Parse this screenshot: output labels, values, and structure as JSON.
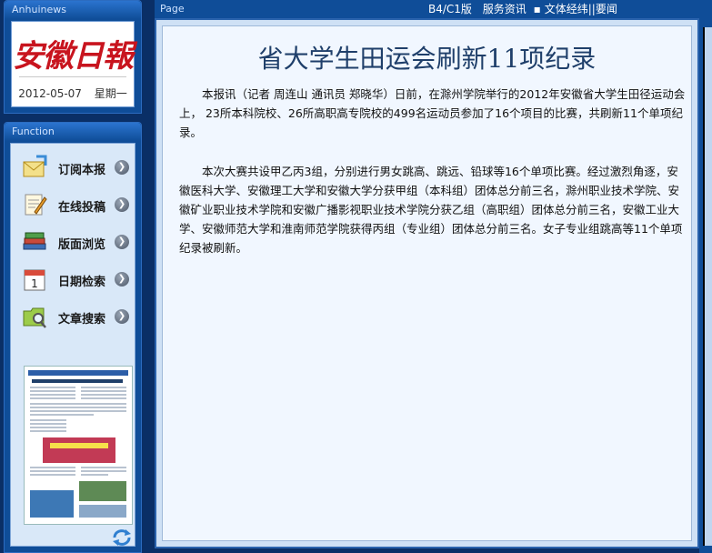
{
  "brand": {
    "header": "Anhuinews",
    "logo_text": "安徽日報",
    "date": "2012-05-07",
    "weekday": "星期一"
  },
  "function_panel": {
    "header": "Function",
    "items": [
      {
        "label": "订阅本报",
        "icon": "mail-icon"
      },
      {
        "label": "在线投稿",
        "icon": "pen-paper-icon"
      },
      {
        "label": "版面浏览",
        "icon": "books-icon"
      },
      {
        "label": "日期检索",
        "icon": "calendar-icon"
      },
      {
        "label": "文章搜索",
        "icon": "folder-search-icon"
      }
    ],
    "calendar_number": "1"
  },
  "page_header": {
    "title": "Page",
    "edition": "B4/C1版",
    "nav": [
      "服务资讯",
      "文体经纬",
      "要闻"
    ]
  },
  "article": {
    "title": "省大学生田运会刷新11项纪录",
    "paragraphs": [
      "本报讯（记者 周连山 通讯员 郑晓华）日前，在滁州学院举行的2012年安徽省大学生田径运动会上， 23所本科院校、26所高职高专院校的499名运动员参加了16个项目的比赛，共刷新11个单项纪录。",
      "本次大赛共设甲乙丙3组，分别进行男女跳高、跳远、铅球等16个单项比赛。经过激烈角逐，安徽医科大学、安徽理工大学和安徽大学分获甲组（本科组）团体总分前三名，滁州职业技术学院、安徽矿业职业技术学院和安徽广播影视职业技术学院分获乙组（高职组）团体总分前三名，安徽工业大学、安徽师范大学和淮南师范学院获得丙组（专业组）团体总分前三名。女子专业组跳高等11个单项纪录被刷新。"
    ]
  },
  "colors": {
    "logo_red": "#c8141e",
    "panel_blue": "#0f4d98",
    "title_blue": "#1f3f6a"
  }
}
